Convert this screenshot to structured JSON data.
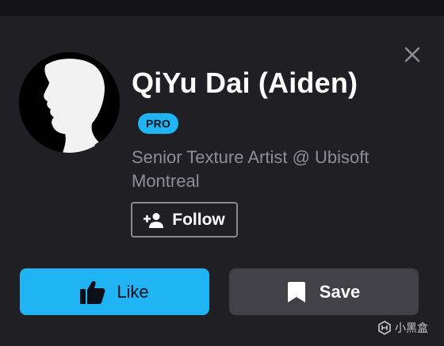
{
  "profile": {
    "name": "QiYu Dai (Aiden)",
    "badge": "PRO",
    "title": "Senior Texture Artist @ Ubisoft Montreal"
  },
  "actions": {
    "follow_label": "Follow",
    "like_label": "Like",
    "save_label": "Save"
  },
  "watermark": {
    "text": "小黑盒"
  },
  "icons": {
    "close": "close-icon",
    "follow": "person-add-icon",
    "like": "thumbs-up-icon",
    "save": "bookmark-icon",
    "watermark": "heybox-logo-icon"
  },
  "colors": {
    "background": "#1f1f24",
    "accent": "#20b4f5",
    "save_button": "#414147",
    "secondary_text": "#8e8e96"
  }
}
